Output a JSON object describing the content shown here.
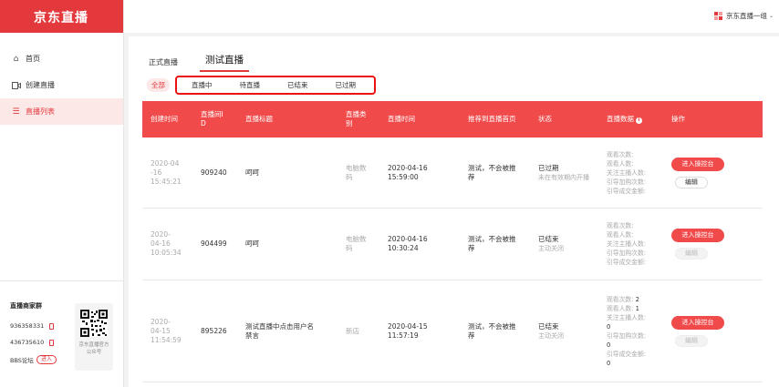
{
  "brand": {
    "logo": "京东直播"
  },
  "sidebar": {
    "items": [
      {
        "label": "首页",
        "icon": "home-icon"
      },
      {
        "label": "创建直播",
        "icon": "video-icon"
      },
      {
        "label": "直播列表",
        "icon": "list-icon"
      }
    ],
    "footer": {
      "title": "直播商家群",
      "phones": [
        "936358331",
        "436735610"
      ],
      "bbs_label": "BBS论坛",
      "bbs_button": "进入",
      "qr_caption": "京东直播官方公众号"
    }
  },
  "header": {
    "user": "京东直播一组"
  },
  "tabs": [
    {
      "label": "正式直播"
    },
    {
      "label": "测试直播"
    }
  ],
  "filters": {
    "all": "全部",
    "items": [
      "直播中",
      "待直播",
      "已结束",
      "已过期"
    ]
  },
  "table": {
    "columns": {
      "created": "创建时间",
      "live_id": "直播间ID",
      "title": "直播标题",
      "category": "直播类别",
      "live_time": "直播时间",
      "recommend": "推荐到直播首页",
      "status": "状态",
      "data": "直播数据",
      "action": "操作"
    },
    "stat_labels": {
      "views": "观看次数:",
      "viewers": "观看人数:",
      "follow": "关注主播人数:",
      "cart": "引导加购次数:",
      "deal": "引导成交金额:"
    },
    "rows": [
      {
        "created_date": "2020-04-16",
        "created_time": "15:45:21",
        "id": "909240",
        "title": "呵呵",
        "category": "电脑数码",
        "live_date": "2020-04-16",
        "live_time": "15:59:00",
        "recommend": "测试，不会被推荐",
        "status": "已过期",
        "status_sub": "未在有效期内开播",
        "stats": {
          "views": "",
          "viewers": "",
          "follow": "",
          "cart": "",
          "deal": ""
        },
        "btn": "进入操控台",
        "edit": "编辑"
      },
      {
        "created_date": "2020-04-16",
        "created_time": "10:05:34",
        "id": "904499",
        "title": "呵呵",
        "category": "电脑数码",
        "live_date": "2020-04-16",
        "live_time": "10:30:24",
        "recommend": "测试，不会被推荐",
        "status": "已结束",
        "status_sub": "主动关闭",
        "stats": {
          "views": "",
          "viewers": "",
          "follow": "",
          "cart": "",
          "deal": ""
        },
        "btn": "进入操控台",
        "edit": "编辑"
      },
      {
        "created_date": "2020-04-15",
        "created_time": "11:54:59",
        "id": "895226",
        "title": "测试直播中点击用户名禁言",
        "category": "新店",
        "live_date": "2020-04-15",
        "live_time": "11:57:19",
        "recommend": "测试，不会被推荐",
        "status": "已结束",
        "status_sub": "主动关闭",
        "stats": {
          "views": "2",
          "viewers": "1",
          "follow": "0",
          "cart": "0",
          "deal": "0"
        },
        "btn": "进入操控台",
        "edit": "编辑"
      }
    ]
  },
  "colors": {
    "brand": "#e4393c",
    "header_row": "#f04a4a",
    "highlight_box": "#ee1111"
  }
}
